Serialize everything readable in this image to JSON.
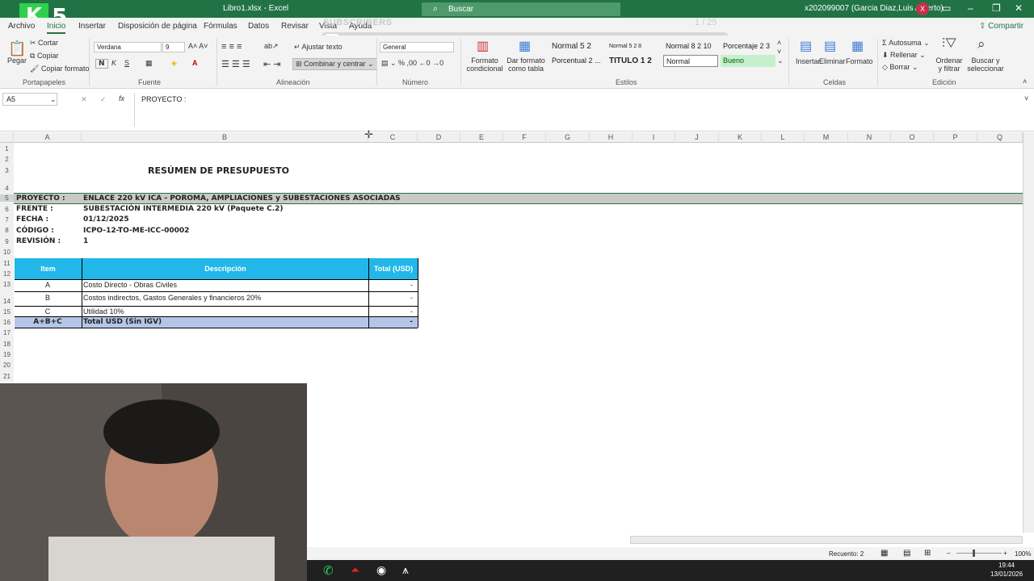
{
  "title_bar": {
    "document": "Libro1.xlsx  -  Excel",
    "search_placeholder": "Buscar",
    "user": "x202099007 (Garcia Diaz,Luis Alberto)",
    "avatar_initial": "X",
    "logo_letter": "K",
    "logo_number": "5"
  },
  "menu_tabs": [
    "Archivo",
    "Inicio",
    "Insertar",
    "Disposición de página",
    "Fórmulas",
    "Datos",
    "Revisar",
    "Vista",
    "Ayuda"
  ],
  "share_label": "Compartir",
  "overlay": {
    "text": "SUBSCRIBERS",
    "counter": "1 / 25"
  },
  "ribbon": {
    "clipboard": {
      "paste": "Pegar",
      "cut": "Cortar",
      "copy": "Copiar",
      "format_painter": "Copiar formato",
      "group": "Portapapeles"
    },
    "font": {
      "name": "Verdana",
      "size": "9",
      "group": "Fuente"
    },
    "alignment": {
      "wrap": "Ajustar texto",
      "merge": "Combinar y centrar",
      "group": "Alineación"
    },
    "number": {
      "format": "General",
      "group": "Número"
    },
    "styles": {
      "conditional": "Formato condicional",
      "as_table": "Dar formato como tabla",
      "cells": [
        "Normal 5 2",
        "Normal 5 2 8",
        "Normal 8 2 10",
        "Porcentaje 2 3",
        "Porcentual 2 ...",
        "TITULO 1 2",
        "Normal",
        "Bueno"
      ],
      "group": "Estilos"
    },
    "cells_group": {
      "insert": "Insertar",
      "delete": "Eliminar",
      "format": "Formato",
      "group": "Celdas"
    },
    "editing": {
      "autosum": "Autosuma",
      "fill": "Rellenar",
      "clear": "Borrar",
      "sort": "Ordenar y filtrar",
      "find": "Buscar y seleccionar",
      "group": "Edición"
    }
  },
  "formula_bar": {
    "name_box": "A5",
    "fx": "fx",
    "content": "PROYECTO :"
  },
  "columns": [
    "A",
    "B",
    "C",
    "D",
    "E",
    "F",
    "G",
    "H",
    "I",
    "J",
    "K",
    "L",
    "M",
    "N",
    "O",
    "P",
    "Q"
  ],
  "rows": [
    "1",
    "2",
    "3",
    "4",
    "5",
    "6",
    "7",
    "8",
    "9",
    "10",
    "11",
    "12",
    "13",
    "14",
    "15",
    "16",
    "17",
    "18",
    "19",
    "20",
    "21"
  ],
  "sheet": {
    "title": "RESÚMEN DE PRESUPUESTO",
    "meta": [
      {
        "label": "PROYECTO :",
        "value": "ENLACE 220 kV ICA - POROMA, AMPLIACIONES y SUBESTACIONES ASOCIADAS"
      },
      {
        "label": "FRENTE     :",
        "value": "SUBESTACIÓN INTERMEDIA 220 kV (Paquete C.2)"
      },
      {
        "label": "FECHA      :",
        "value": "01/12/2025"
      },
      {
        "label": "CÓDIGO     :",
        "value": "ICPO-12-TO-ME-ICC-00002"
      },
      {
        "label": "REVISIÓN  :",
        "value": "1"
      }
    ],
    "table": {
      "headers": [
        "Item",
        "Descripción",
        "Total (USD)"
      ],
      "rows": [
        {
          "item": "A",
          "desc": "Costo Directo - Obras Civiles",
          "total": "-"
        },
        {
          "item": "B",
          "desc": "Costos indirectos, Gastos Generales y financieros 20%",
          "total": "-"
        },
        {
          "item": "C",
          "desc": "Utilidad 10%",
          "total": "-"
        }
      ],
      "total_row": {
        "item": "A+B+C",
        "desc": "Total USD (Sin IGV)",
        "total": "-"
      }
    }
  },
  "status_bar": {
    "count": "Recuento: 2",
    "zoom": "100%"
  },
  "taskbar": {
    "time": "19:44",
    "date": "13/01/2026"
  }
}
